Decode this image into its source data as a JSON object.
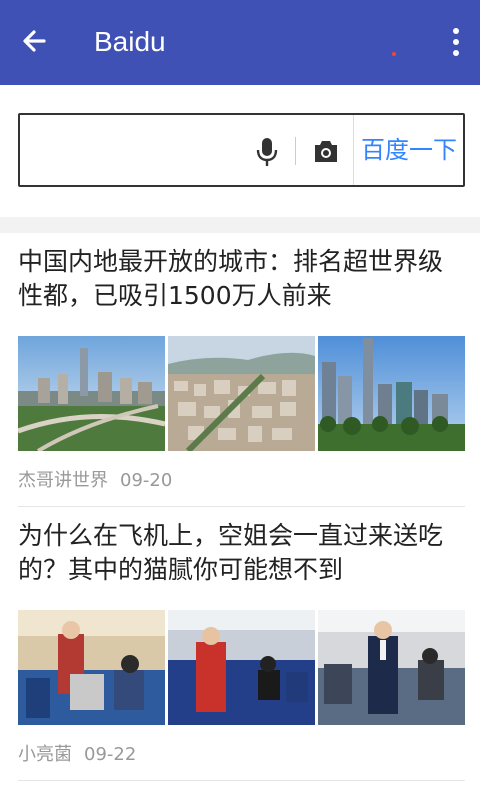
{
  "appbar": {
    "title": "Baidu",
    "back_icon": "arrow-back-icon",
    "more_icon": "more-vert-icon",
    "color": "#3f51b5"
  },
  "search": {
    "value": "",
    "mic_icon": "microphone-icon",
    "camera_icon": "camera-icon",
    "submit_label": "百度一下",
    "accent": "#3385ff"
  },
  "feed": {
    "items": [
      {
        "title": "中国内地最开放的城市：排名超世界级性都，已吸引1500万人前来",
        "author": "杰哥讲世界",
        "date": "09-20",
        "images": [
          "city-skyline-photo",
          "city-aerial-photo",
          "city-towers-photo"
        ]
      },
      {
        "title": "为什么在飞机上，空姐会一直过来送吃的？其中的猫腻你可能想不到",
        "author": "小亮菌",
        "date": "09-22",
        "images": [
          "flight-attendant-cart-photo",
          "flight-attendant-serving-photo",
          "flight-attendant-aisle-photo"
        ]
      }
    ]
  }
}
